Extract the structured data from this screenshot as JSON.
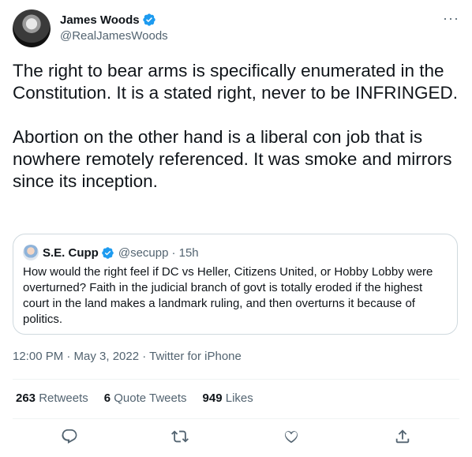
{
  "author": {
    "name": "James Woods",
    "handle": "@RealJamesWoods",
    "verified": true
  },
  "tweet": {
    "text": "The right to bear arms is specifically enumerated in the Constitution. It is a stated right, never to be INFRINGED.\n\nAbortion on the other hand is a liberal con job that is nowhere remotely referenced. It was smoke and mirrors since its inception.",
    "timestamp": "12:00 PM · May 3, 2022 · Twitter for iPhone"
  },
  "quoted_tweet": {
    "name": "S.E. Cupp",
    "handle": "@secupp",
    "age": "· 15h",
    "text": "How would the right feel if DC vs Heller, Citizens United, or Hobby Lobby were overturned? Faith in the judicial branch of govt is totally eroded if the highest court in the land makes a landmark ruling, and then overturns it because of politics."
  },
  "stats": {
    "retweets_count": "263",
    "retweets_label": "Retweets",
    "quotes_count": "6",
    "quotes_label": "Quote Tweets",
    "likes_count": "949",
    "likes_label": "Likes"
  },
  "more_menu": "···",
  "colors": {
    "verified": "#1d9bf0",
    "secondary_text": "#536471",
    "border": "#cfd9de"
  },
  "icons": [
    "more-icon",
    "verified-icon",
    "reply-icon",
    "retweet-icon",
    "like-icon",
    "share-icon"
  ]
}
